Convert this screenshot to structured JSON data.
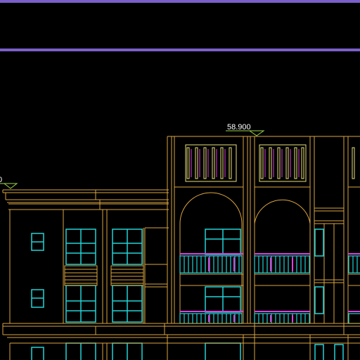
{
  "canvas": {
    "background": "#000000",
    "separator_color": "#7b5fc9"
  },
  "colors": {
    "wall": "#d9a441",
    "glazing": "#22d3d6",
    "railing": "#22d3d6",
    "balustrade_accent": "#e040e0",
    "shutter": "#e8e07a",
    "level_marker": "#9bd44a",
    "label": "#ffffff"
  },
  "elevation_labels": {
    "roof_level": "58.900",
    "left_level": "0"
  }
}
